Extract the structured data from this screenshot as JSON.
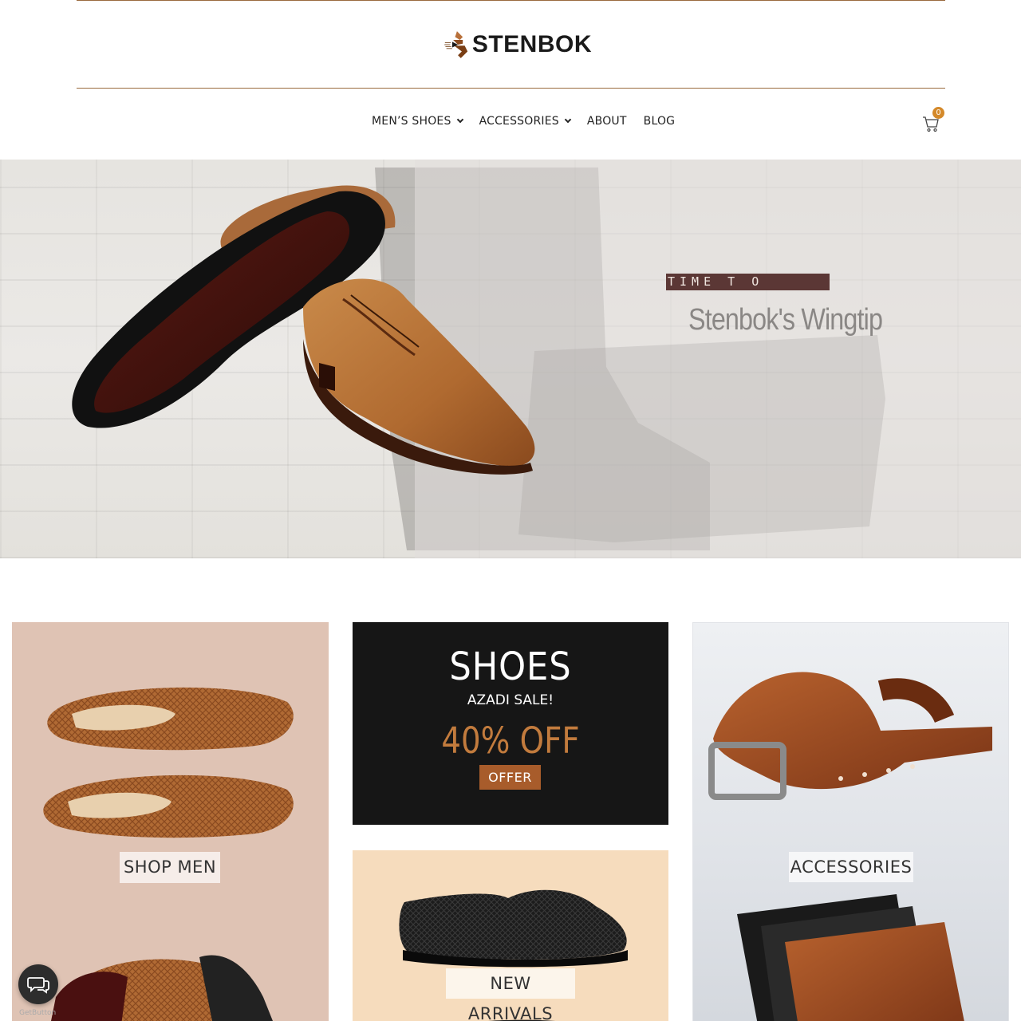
{
  "header": {
    "brand": "STENBOK",
    "nav": [
      {
        "label": "MEN’S SHOES",
        "has_dropdown": true
      },
      {
        "label": "ACCESSORIES",
        "has_dropdown": true
      },
      {
        "label": "ABOUT",
        "has_dropdown": false
      },
      {
        "label": "BLOG",
        "has_dropdown": false
      }
    ],
    "cart_count": "0",
    "icons": {
      "cart": "cart-icon",
      "chevron": "chevron-down-icon"
    }
  },
  "hero": {
    "tag": "TIME  T  O",
    "title": "Stenbok's Wingtip"
  },
  "cards": {
    "men": {
      "label": "SHOP MEN"
    },
    "sale": {
      "title": "SHOES",
      "subtitle": "AZADI SALE!",
      "discount": "40% OFF",
      "button": "OFFER"
    },
    "new": {
      "label": "NEW ARRIVALS"
    },
    "accessories": {
      "label": "ACCESSORIES"
    }
  },
  "chat": {
    "label": "GetButton",
    "icon": "chat-bubbles-icon"
  },
  "colors": {
    "accent": "#a85c2b",
    "badge": "#d4892a",
    "rule": "#9a6a3e",
    "tag_bg": "#5b3735"
  }
}
